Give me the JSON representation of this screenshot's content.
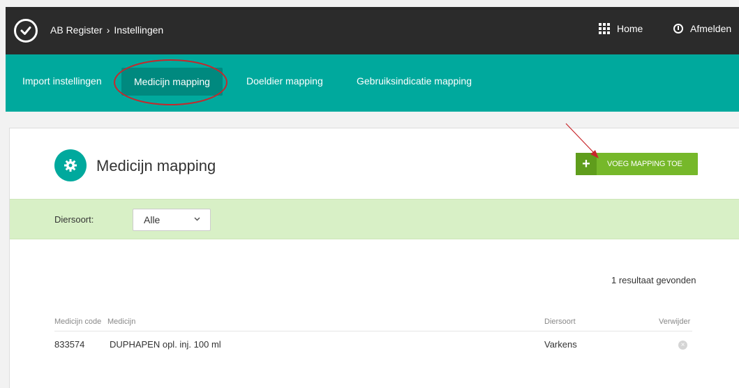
{
  "header": {
    "breadcrumb": [
      "AB Register",
      "Instellingen"
    ],
    "breadcrumb_separator": "›",
    "home_label": "Home",
    "logout_label": "Afmelden"
  },
  "tabs": [
    {
      "label": "Import instellingen",
      "active": false
    },
    {
      "label": "Medicijn mapping",
      "active": true
    },
    {
      "label": "Doeldier mapping",
      "active": false
    },
    {
      "label": "Gebruiksindicatie mapping",
      "active": false
    }
  ],
  "page": {
    "title": "Medicijn mapping",
    "add_button_label": "VOEG MAPPING TOE"
  },
  "filter": {
    "label": "Diersoort:",
    "selected": "Alle"
  },
  "results": {
    "count_text": "1 resultaat gevonden",
    "columns": [
      "Medicijn code",
      "Medicijn",
      "Diersoort",
      "Verwijder"
    ],
    "rows": [
      {
        "code": "833574",
        "medicijn": "DUPHAPEN opl. inj. 100 ml",
        "diersoort": "Varkens"
      }
    ]
  },
  "colors": {
    "teal": "#00a99d",
    "dark": "#2b2b2b",
    "green_button": "#76b82a",
    "filter_bg": "#d8f0c6",
    "annotation_red": "#c8262b"
  }
}
